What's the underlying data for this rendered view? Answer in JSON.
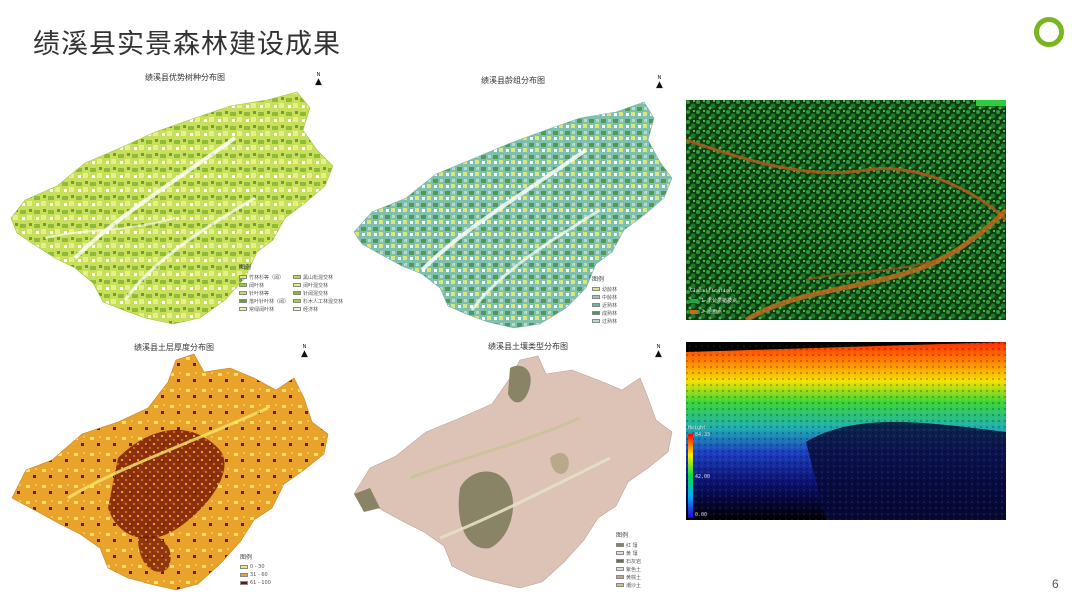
{
  "slide": {
    "title": "绩溪县实景森林建设成果",
    "page_number": "6",
    "accent_color": "#7ab51d"
  },
  "maps": {
    "tree_species": {
      "title": "绩溪县优势树种分布图",
      "legend_title": "图例",
      "legend_left": [
        "竹林杉等（阔）",
        "阔叶林",
        "针叶林等",
        "落叶针叶林（阔）",
        "常绿阔叶林"
      ],
      "legend_right": [
        "黑山松混交林",
        "阔叶混交林",
        "针阔混交林",
        "杉木人工林混交林",
        "",
        "经济林"
      ],
      "colors": [
        "#d7ea6a",
        "#9cc43a",
        "#c3df5c",
        "#6a9e2a",
        "#eef59a",
        "#b5d94a",
        "#e3f08a",
        "#88b833"
      ]
    },
    "age_group": {
      "title": "绩溪县龄组分布图",
      "legend_title": "图例",
      "legend": [
        "幼龄林",
        "中龄林",
        "近熟林",
        "成熟林",
        "过熟林"
      ],
      "colors": [
        "#d9e67a",
        "#93c7c2",
        "#6fb3a5",
        "#4f9a55",
        "#b6dcc9"
      ]
    },
    "soil_depth": {
      "title": "绩溪县土层厚度分布图",
      "legend_title": "图例",
      "legend": [
        "0 - 30",
        "31 - 60",
        "61 - 100"
      ],
      "colors": [
        "#f5e76a",
        "#e9a32b",
        "#6e1608"
      ]
    },
    "soil_type": {
      "title": "绩溪县土壤类型分布图",
      "legend_title": "图例",
      "legend": [
        "红 壤",
        "黄 壤",
        "石灰岩",
        "紫色土",
        "黄棕土",
        "潮沙土"
      ],
      "colors": [
        "#d9bdb0",
        "#ecdccf",
        "#8a8466",
        "#b9a98a",
        "#c9c39a",
        "#e6e0c3"
      ]
    }
  },
  "photos": {
    "lidar_classification": {
      "header": "Classification",
      "legend": [
        "1-未分类植被点",
        "2-地面点"
      ],
      "colors": [
        "#22a84a",
        "#c96a1e"
      ]
    },
    "lidar_height": {
      "header": "Height",
      "max_label": "84.33",
      "mid_label": "42.00",
      "min_label": "0.00"
    }
  }
}
